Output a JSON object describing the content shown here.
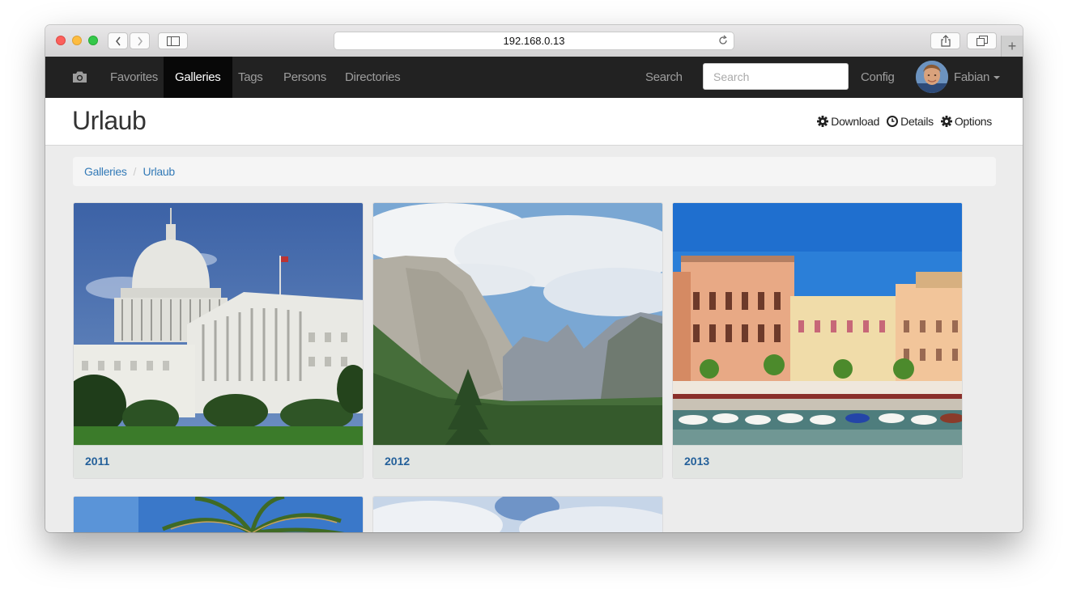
{
  "browser": {
    "url": "192.168.0.13"
  },
  "navbar": {
    "items": [
      {
        "label": "Favorites",
        "active": false
      },
      {
        "label": "Galleries",
        "active": true
      },
      {
        "label": "Tags",
        "active": false
      },
      {
        "label": "Persons",
        "active": false
      },
      {
        "label": "Directories",
        "active": false
      }
    ],
    "search_label": "Search",
    "search_placeholder": "Search",
    "config_label": "Config",
    "user_name": "Fabian"
  },
  "header": {
    "title": "Urlaub",
    "actions": [
      {
        "label": "Download",
        "icon": "gear-icon"
      },
      {
        "label": "Details",
        "icon": "clock-icon"
      },
      {
        "label": "Options",
        "icon": "gear-icon"
      }
    ]
  },
  "breadcrumb": [
    "Galleries",
    "Urlaub"
  ],
  "galleries": [
    {
      "label": "2011"
    },
    {
      "label": "2012"
    },
    {
      "label": "2013"
    },
    {
      "label": ""
    },
    {
      "label": ""
    }
  ],
  "colors": {
    "navbar_bg": "#222222",
    "navbar_active_bg": "#080808",
    "link": "#337ab7",
    "caption_text": "#24609a"
  }
}
